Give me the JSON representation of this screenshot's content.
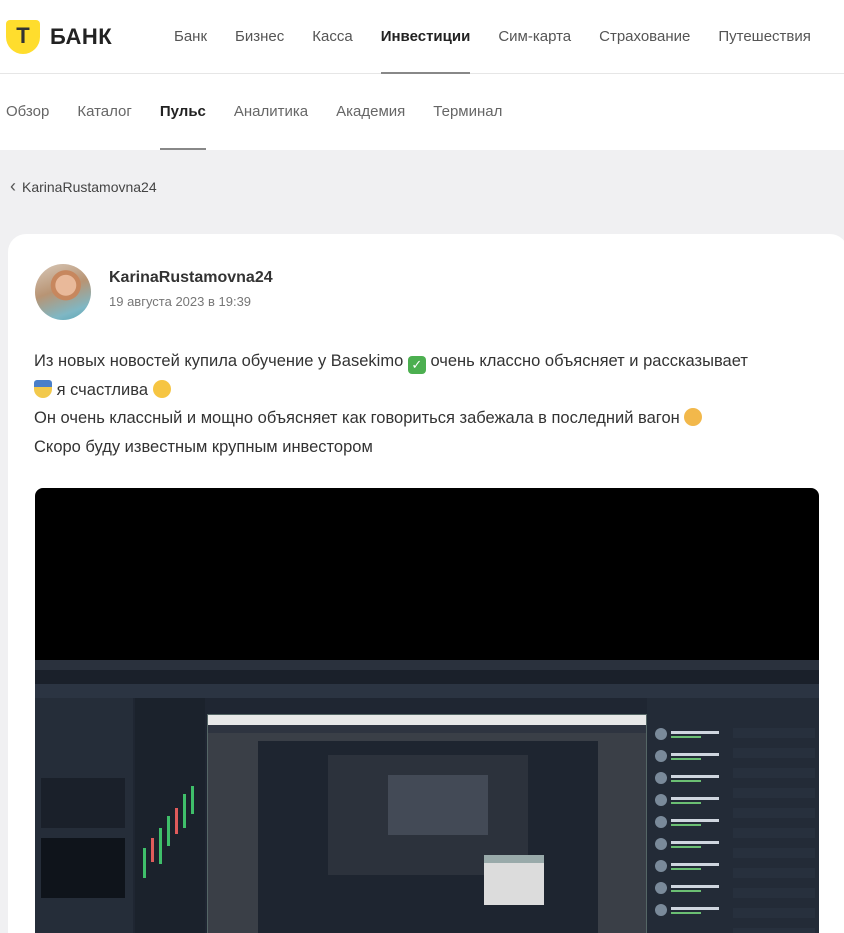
{
  "brand": {
    "mark": "T",
    "name": "БАНК"
  },
  "top_nav": [
    {
      "label": "Банк",
      "active": false
    },
    {
      "label": "Бизнес",
      "active": false
    },
    {
      "label": "Касса",
      "active": false
    },
    {
      "label": "Инвестиции",
      "active": true
    },
    {
      "label": "Сим-карта",
      "active": false
    },
    {
      "label": "Страхование",
      "active": false
    },
    {
      "label": "Путешествия",
      "active": false
    }
  ],
  "sub_nav": [
    {
      "label": "Обзор",
      "active": false
    },
    {
      "label": "Каталог",
      "active": false
    },
    {
      "label": "Пульс",
      "active": true
    },
    {
      "label": "Аналитика",
      "active": false
    },
    {
      "label": "Академия",
      "active": false
    },
    {
      "label": "Терминал",
      "active": false
    }
  ],
  "back": {
    "label": "KarinaRustamovna24",
    "icon": "chevron-left-icon"
  },
  "post": {
    "author": "KarinaRustamovna24",
    "date": "19 августа 2023 в 19:39",
    "line1_a": "Из новых новостей купила обучение у Basekimo ",
    "line1_b": "очень классно объясняет и рассказывает",
    "line2": "я счастлива ",
    "line3": "Он очень классный и мощно объясняет как говориться забежала в последний вагон ",
    "line4": "Скоро буду известным крупным инвестором",
    "emoji": [
      "check-mark-icon",
      "medal-icon",
      "smiling-face-icon",
      "face-icon"
    ]
  },
  "colors": {
    "brand_yellow": "#ffdd2d",
    "background": "#f0f0f2",
    "card": "#ffffff"
  }
}
